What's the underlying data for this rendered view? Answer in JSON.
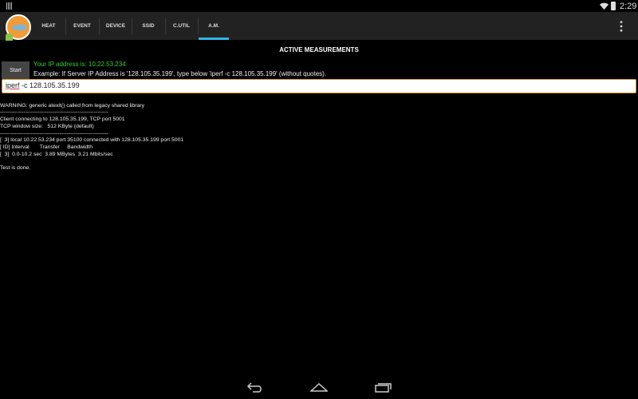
{
  "status_bar": {
    "time": "2:29",
    "icons": [
      "notification-icon",
      "wifi-icon",
      "battery-icon"
    ]
  },
  "tabs": [
    {
      "label": "HEAT"
    },
    {
      "label": "EVENT"
    },
    {
      "label": "DEVICE"
    },
    {
      "label": "SSID"
    },
    {
      "label": "C.UTIL"
    },
    {
      "label": "A.M.",
      "selected": true
    }
  ],
  "accent": "#33b5e5",
  "page_title": "ACTIVE MEASUREMENTS",
  "start_label": "Start",
  "ip_text": "Your IP address is: 10.22.53.234",
  "example_text": "Example: If Server IP Address is '128.105.35.199', type below 'iperf -c 128.105.35.199' (without quotes).",
  "command": {
    "word": "iperf",
    "rest": " -c 128.105.35.199"
  },
  "log": [
    "WARNING: generic atexit() called from legacy shared library",
    "------------------------------------------------------------",
    "Client connecting to 128.105.35.199, TCP port 5001",
    "TCP window size:   512 KByte (default)",
    "------------------------------------------------------------",
    "[  3] local 10.22.53.234 port 35100 connected with 128.105.35.199 port 5001",
    "[ ID] Interval       Transfer     Bandwidth",
    "[  3]  0.0-10.2 sec  3.89 MBytes  3.21 Mbits/sec",
    "",
    "Test is done."
  ]
}
